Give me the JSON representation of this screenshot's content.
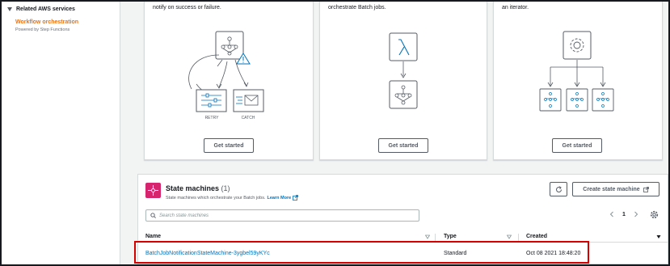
{
  "sidebar": {
    "section_title": "Related AWS services",
    "link_label": "Workflow orchestration",
    "link_sub": "Powered by Step Functions"
  },
  "cards": [
    {
      "text": "notify on success or failure.",
      "retry_label": "RETRY",
      "catch_label": "CATCH",
      "button": "Get started"
    },
    {
      "text": "orchestrate Batch jobs.",
      "button": "Get started"
    },
    {
      "text": "an iterator.",
      "button": "Get started"
    }
  ],
  "state_machines": {
    "title": "State machines",
    "count": "(1)",
    "description": "State machines which orchestrate your Batch jobs.",
    "learn_more": "Learn More",
    "create_button": "Create state machine",
    "search_placeholder": "Search state machines",
    "page_number": "1",
    "columns": [
      "Name",
      "Type",
      "Created"
    ],
    "rows": [
      {
        "name": "BatchJobNotificationStateMachine-3ygbel59yKYc",
        "type": "Standard",
        "created": "Oct 08 2021 18:48:20"
      }
    ]
  },
  "colors": {
    "accent_orange": "#ec7211",
    "link_blue": "#0073bb",
    "icon_pink": "#d6246e",
    "highlight_red": "#d50000"
  }
}
